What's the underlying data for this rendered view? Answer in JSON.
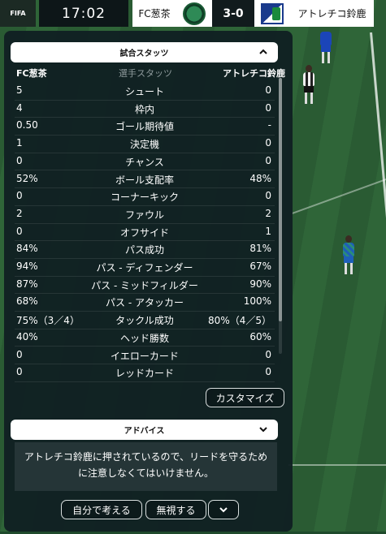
{
  "scoreboard": {
    "fifa_logo": "FIFA",
    "clock": "17:02",
    "home_team": "FC葱茶",
    "score": "3-0",
    "away_team": "アトレチコ鈴鹿"
  },
  "stats_panel": {
    "header": "試合スタッツ",
    "home_column": "FC葱茶",
    "middle_column": "選手スタッツ",
    "away_column": "アトレチコ鈴鹿",
    "rows": [
      {
        "name": "シュート",
        "home": "5",
        "away": "0"
      },
      {
        "name": "枠内",
        "home": "4",
        "away": "0"
      },
      {
        "name": "ゴール期待値",
        "home": "0.50",
        "away": "-"
      },
      {
        "name": "決定機",
        "home": "1",
        "away": "0"
      },
      {
        "name": "チャンス",
        "home": "0",
        "away": "0"
      },
      {
        "name": "ボール支配率",
        "home": "52%",
        "away": "48%"
      },
      {
        "name": "コーナーキック",
        "home": "0",
        "away": "0"
      },
      {
        "name": "ファウル",
        "home": "2",
        "away": "2"
      },
      {
        "name": "オフサイド",
        "home": "0",
        "away": "1"
      },
      {
        "name": "パス成功",
        "home": "84%",
        "away": "81%"
      },
      {
        "name": "パス - ディフェンダー",
        "home": "94%",
        "away": "67%"
      },
      {
        "name": "パス - ミッドフィルダー",
        "home": "87%",
        "away": "90%"
      },
      {
        "name": "パス - アタッカー",
        "home": "68%",
        "away": "100%"
      },
      {
        "name": "タックル成功",
        "home": "75%（3／4）",
        "away": "80%（4／5）"
      },
      {
        "name": "ヘッド勝数",
        "home": "40%",
        "away": "60%"
      },
      {
        "name": "イエローカード",
        "home": "0",
        "away": "0"
      },
      {
        "name": "レッドカード",
        "home": "0",
        "away": "0"
      }
    ],
    "customize_label": "カスタマイズ"
  },
  "advice_panel": {
    "header": "アドバイス",
    "message": "アトレチコ鈴鹿に押されているので、リードを守るために注意しなくてはいけません。",
    "think_label": "自分で考える",
    "ignore_label": "無視する"
  },
  "colors": {
    "home": "#1e6b3c",
    "away": "#1a3a8c",
    "panel": "#101f22"
  }
}
